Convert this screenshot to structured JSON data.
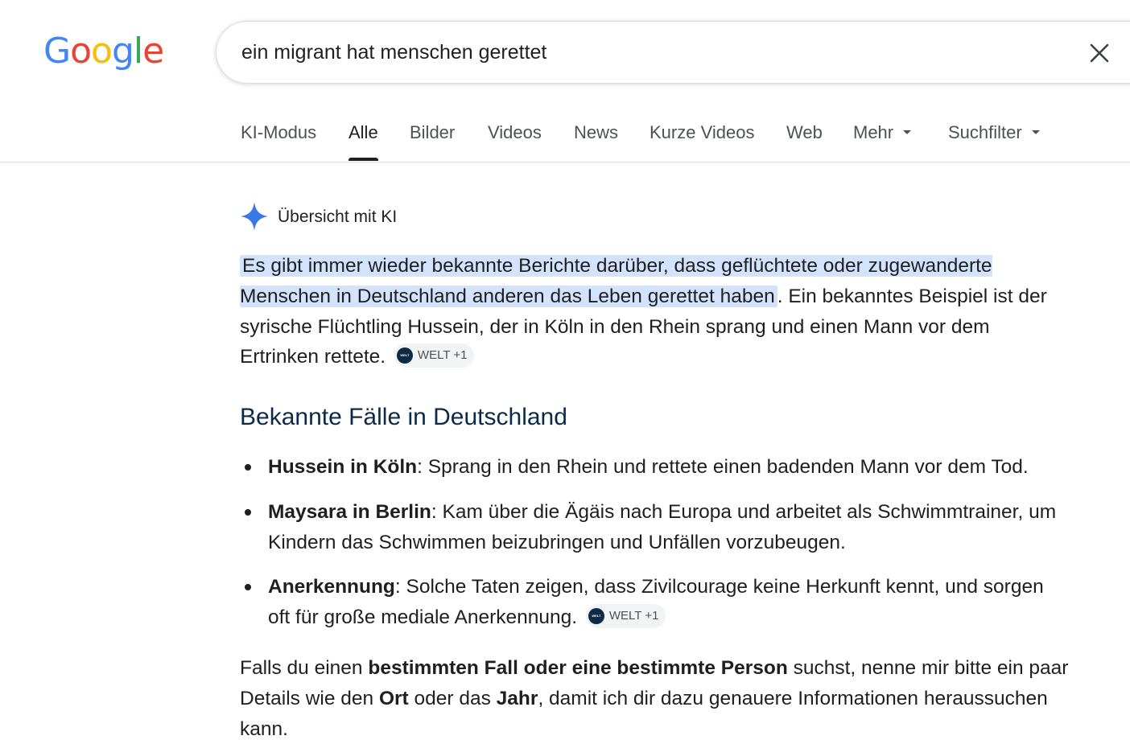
{
  "logo": {
    "letters": [
      "G",
      "o",
      "o",
      "g",
      "l",
      "e"
    ],
    "colors": [
      "#4285F4",
      "#EA4335",
      "#FBBC05",
      "#4285F4",
      "#34A853",
      "#EA4335"
    ]
  },
  "search": {
    "query": "ein migrant hat menschen gerettet",
    "clear_icon": "close-icon"
  },
  "tabs": [
    {
      "label": "KI-Modus"
    },
    {
      "label": "Alle",
      "active": true
    },
    {
      "label": "Bilder"
    },
    {
      "label": "Videos"
    },
    {
      "label": "News"
    },
    {
      "label": "Kurze Videos"
    },
    {
      "label": "Web"
    },
    {
      "label": "Mehr"
    },
    {
      "label": "Suchfilter"
    }
  ],
  "ai_overview": {
    "title": "Übersicht mit KI",
    "icon": "sparkle-icon",
    "accent": "#4285F4",
    "intro_highlight": "Es gibt immer wieder bekannte Berichte darüber, dass geflüchtete oder zugewanderte Menschen in Deutschland anderen das Leben gerettet haben",
    "intro_rest": ". Ein bekanntes Beispiel ist der syrische Flüchtling Hussein, der in Köln in den Rhein sprang und einen Mann vor dem Ertrinken rettete.",
    "source_1": {
      "label": "WELT +1",
      "logo_text": "WELT"
    },
    "heading": "Bekannte Fälle in Deutschland",
    "bullets": [
      {
        "bold": "Hussein in Köln",
        "text": ": Sprang in den Rhein und rettete einen badenden Mann vor dem Tod."
      },
      {
        "bold": "Maysara in Berlin",
        "text": ": Kam über die Ägäis nach Europa und arbeitet als Schwimmtrainer, um Kindern das Schwimmen beizubringen und Unfällen vorzubeugen."
      },
      {
        "bold": "Anerkennung",
        "text": ": Solche Taten zeigen, dass Zivilcourage keine Herkunft kennt, und sorgen oft für große mediale Anerkennung."
      }
    ],
    "source_2": {
      "label": "WELT +1",
      "logo_text": "WELT"
    },
    "footer": {
      "t1": "Falls du einen ",
      "b1": "bestimmten Fall oder eine bestimmte Person",
      "t2": " suchst, nenne mir bitte ein paar Details wie den ",
      "b2": "Ort",
      "t3": " oder das ",
      "b3": "Jahr",
      "t4": ", damit ich dir dazu genauere Informationen heraussuchen kann."
    }
  }
}
